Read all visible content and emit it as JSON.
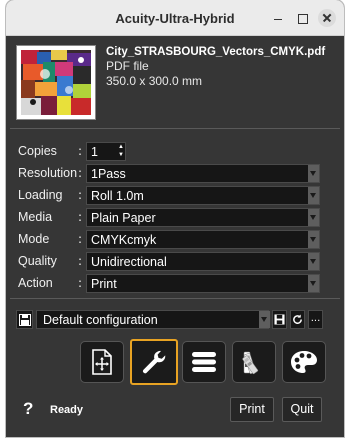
{
  "window": {
    "title": "Acuity-Ultra-Hybrid"
  },
  "file": {
    "name": "City_STRASBOURG_Vectors_CMYK.pdf",
    "type": "PDF file",
    "size": "350.0 x 300.0 mm"
  },
  "form": {
    "copies": {
      "label": "Copies",
      "value": "1"
    },
    "rows": [
      {
        "label": "Resolution",
        "value": "1Pass"
      },
      {
        "label": "Loading",
        "value": "Roll 1.0m"
      },
      {
        "label": "Media",
        "value": "Plain Paper"
      },
      {
        "label": "Mode",
        "value": "CMYKcmyk"
      },
      {
        "label": "Quality",
        "value": "Unidirectional"
      },
      {
        "label": "Action",
        "value": "Print"
      }
    ],
    "colon": ":"
  },
  "config": {
    "value": "Default configuration",
    "more_label": "..."
  },
  "tools": [
    {
      "icon": "add-page-icon",
      "active": false
    },
    {
      "icon": "wrench-icon",
      "active": true
    },
    {
      "icon": "list-icon",
      "active": false
    },
    {
      "icon": "color-swatches-icon",
      "active": false
    },
    {
      "icon": "palette-icon",
      "active": false
    }
  ],
  "footer": {
    "help_label": "?",
    "status": "Ready",
    "print_label": "Print",
    "quit_label": "Quit"
  },
  "colors": {
    "background": "#363636",
    "field": "#161616",
    "accent": "#e8a323",
    "titlebar": "#ebebeb"
  }
}
